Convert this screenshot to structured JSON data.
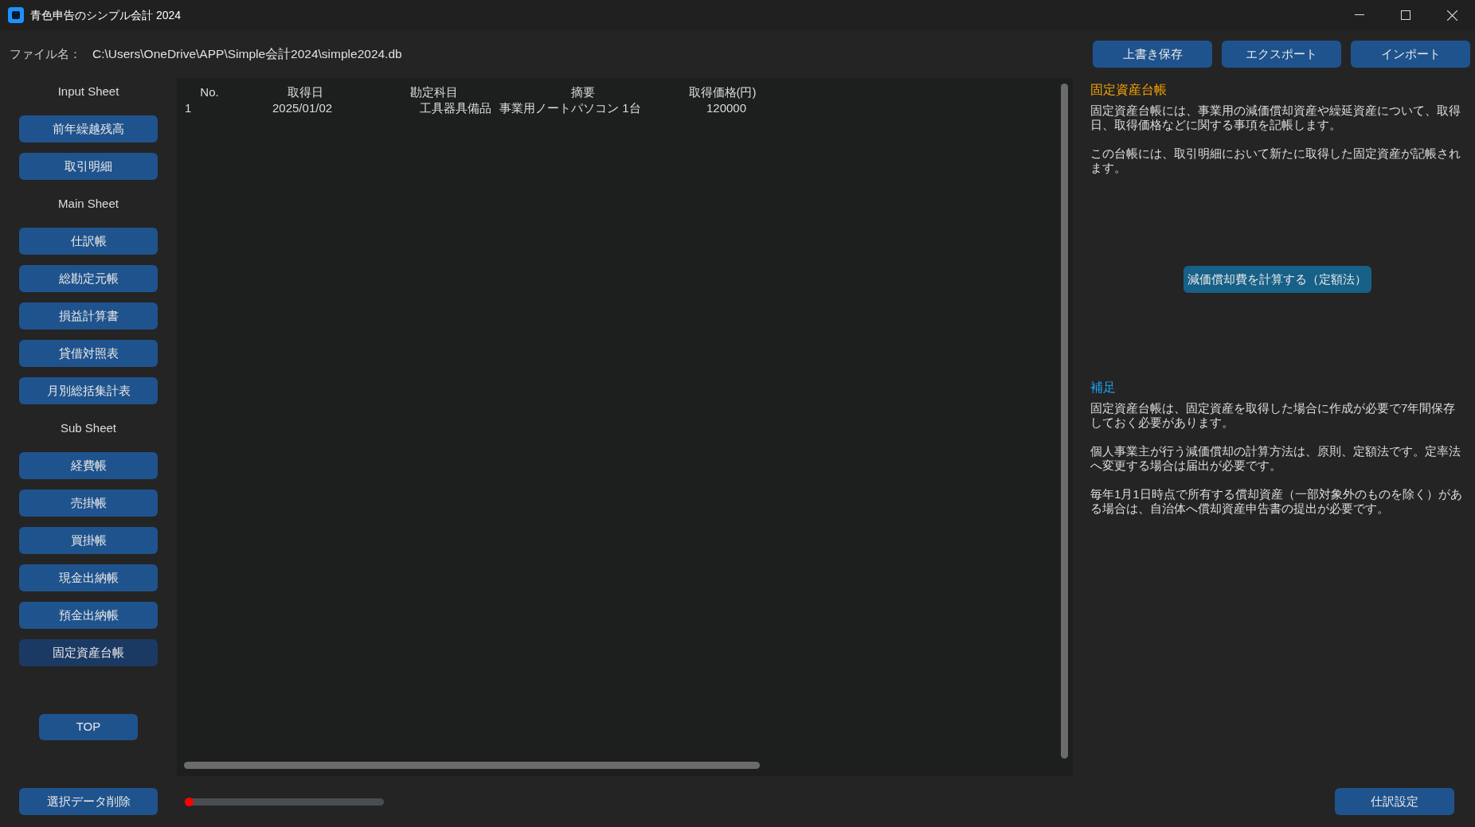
{
  "window": {
    "title": "青色申告のシンプル会計 2024"
  },
  "file": {
    "label": "ファイル名：",
    "path": "C:\\Users\\OneDrive\\APP\\Simple会計2024\\simple2024.db"
  },
  "toolbar": [
    "上書き保存",
    "エクスポート",
    "インポート"
  ],
  "sidebar": [
    {
      "kind": "heading",
      "label": "Input Sheet"
    },
    {
      "kind": "button",
      "label": "前年繰越残高",
      "selected": false
    },
    {
      "kind": "button",
      "label": "取引明細",
      "selected": false
    },
    {
      "kind": "heading",
      "label": "Main Sheet"
    },
    {
      "kind": "button",
      "label": "仕訳帳",
      "selected": false
    },
    {
      "kind": "button",
      "label": "総勘定元帳",
      "selected": false
    },
    {
      "kind": "button",
      "label": "損益計算書",
      "selected": false
    },
    {
      "kind": "button",
      "label": "貸借対照表",
      "selected": false
    },
    {
      "kind": "button",
      "label": "月別総括集計表",
      "selected": false
    },
    {
      "kind": "heading",
      "label": "Sub Sheet"
    },
    {
      "kind": "button",
      "label": "経費帳",
      "selected": false
    },
    {
      "kind": "button",
      "label": "売掛帳",
      "selected": false
    },
    {
      "kind": "button",
      "label": "買掛帳",
      "selected": false
    },
    {
      "kind": "button",
      "label": "現金出納帳",
      "selected": false
    },
    {
      "kind": "button",
      "label": "預金出納帳",
      "selected": false
    },
    {
      "kind": "button",
      "label": "固定資産台帳",
      "selected": true
    }
  ],
  "top_button": "TOP",
  "table": {
    "columns": [
      "No.",
      "取得日",
      "勘定科目",
      "摘要",
      "取得価格(円)"
    ],
    "rows": [
      [
        "1",
        "2025/01/02",
        "工具器具備品",
        "事業用ノートパソコン 1台",
        "120000"
      ]
    ]
  },
  "info": {
    "title": "固定資産台帳",
    "paragraphs": [
      "固定資産台帳には、事業用の減価償却資産や繰延資産について、取得日、取得価格などに関する事項を記帳します。",
      "この台帳には、取引明細において新たに取得した固定資産が記帳されます。"
    ],
    "action": "減価償却費を計算する（定額法）",
    "note_title": "補足",
    "notes": [
      "固定資産台帳は、固定資産を取得した場合に作成が必要で7年間保存しておく必要があります。",
      "個人事業主が行う減価償却の計算方法は、原則、定額法です。定率法へ変更する場合は届出が必要です。",
      "毎年1月1日時点で所有する償却資産（一部対象外のものを除く）がある場合は、自治体へ償却資産申告書の提出が必要です。"
    ]
  },
  "footer": {
    "delete_button": "選択データ削除",
    "slider": {
      "level": 0
    },
    "settings_button": "仕訳設定"
  }
}
